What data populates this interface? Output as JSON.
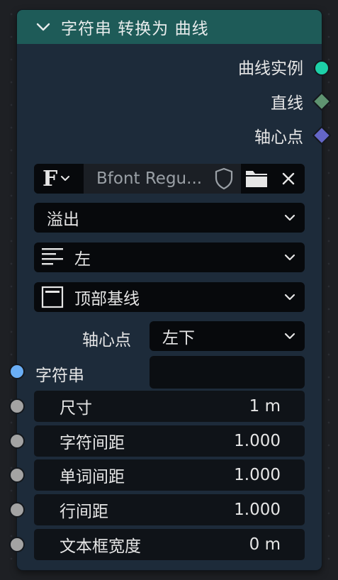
{
  "node": {
    "title": "字符串 转换为 曲线",
    "outputs": [
      {
        "label": "曲线实例",
        "color": "#1dd0a8",
        "shape": "circle"
      },
      {
        "label": "直线",
        "color": "#5f9471",
        "shape": "diamond"
      },
      {
        "label": "轴心点",
        "color": "#6466c7",
        "shape": "diamond"
      }
    ],
    "font": {
      "name": "Bfont Regu..."
    },
    "overflow": {
      "value": "溢出"
    },
    "align_x": {
      "value": "左"
    },
    "align_y": {
      "value": "顶部基线"
    },
    "pivot": {
      "label": "轴心点",
      "value": "左下"
    },
    "string_input": {
      "label": "字符串",
      "value": "",
      "socket_color": "#6aaef5"
    },
    "fields": [
      {
        "label": "尺寸",
        "value": "1 m"
      },
      {
        "label": "字符间距",
        "value": "1.000"
      },
      {
        "label": "单词间距",
        "value": "1.000"
      },
      {
        "label": "行间距",
        "value": "1.000"
      },
      {
        "label": "文本框宽度",
        "value": "0 m"
      }
    ],
    "colors": {
      "header": "#1e5b58",
      "body": "#1d2b3a",
      "field": "#0f1318",
      "grey_socket": "#a3a3a3"
    }
  }
}
